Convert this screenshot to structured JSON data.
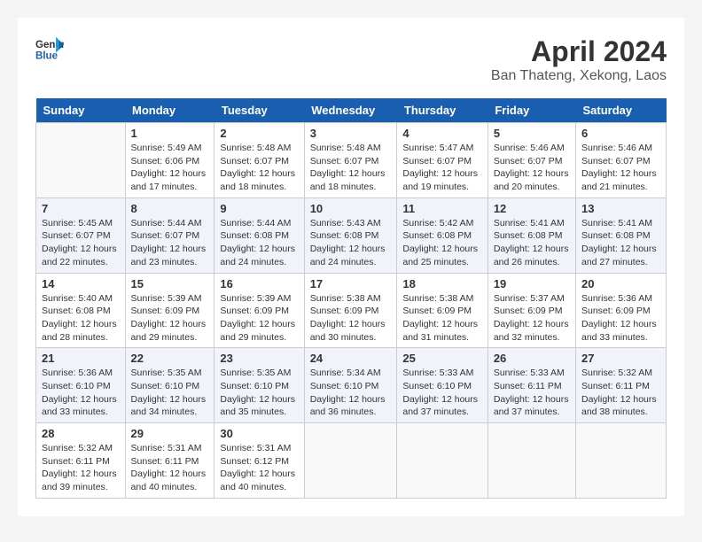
{
  "header": {
    "logo_line1": "General",
    "logo_line2": "Blue",
    "title": "April 2024",
    "location": "Ban Thateng, Xekong, Laos"
  },
  "columns": [
    "Sunday",
    "Monday",
    "Tuesday",
    "Wednesday",
    "Thursday",
    "Friday",
    "Saturday"
  ],
  "weeks": [
    [
      {
        "day": "",
        "info": ""
      },
      {
        "day": "1",
        "info": "Sunrise: 5:49 AM\nSunset: 6:06 PM\nDaylight: 12 hours\nand 17 minutes."
      },
      {
        "day": "2",
        "info": "Sunrise: 5:48 AM\nSunset: 6:07 PM\nDaylight: 12 hours\nand 18 minutes."
      },
      {
        "day": "3",
        "info": "Sunrise: 5:48 AM\nSunset: 6:07 PM\nDaylight: 12 hours\nand 18 minutes."
      },
      {
        "day": "4",
        "info": "Sunrise: 5:47 AM\nSunset: 6:07 PM\nDaylight: 12 hours\nand 19 minutes."
      },
      {
        "day": "5",
        "info": "Sunrise: 5:46 AM\nSunset: 6:07 PM\nDaylight: 12 hours\nand 20 minutes."
      },
      {
        "day": "6",
        "info": "Sunrise: 5:46 AM\nSunset: 6:07 PM\nDaylight: 12 hours\nand 21 minutes."
      }
    ],
    [
      {
        "day": "7",
        "info": "Sunrise: 5:45 AM\nSunset: 6:07 PM\nDaylight: 12 hours\nand 22 minutes."
      },
      {
        "day": "8",
        "info": "Sunrise: 5:44 AM\nSunset: 6:07 PM\nDaylight: 12 hours\nand 23 minutes."
      },
      {
        "day": "9",
        "info": "Sunrise: 5:44 AM\nSunset: 6:08 PM\nDaylight: 12 hours\nand 24 minutes."
      },
      {
        "day": "10",
        "info": "Sunrise: 5:43 AM\nSunset: 6:08 PM\nDaylight: 12 hours\nand 24 minutes."
      },
      {
        "day": "11",
        "info": "Sunrise: 5:42 AM\nSunset: 6:08 PM\nDaylight: 12 hours\nand 25 minutes."
      },
      {
        "day": "12",
        "info": "Sunrise: 5:41 AM\nSunset: 6:08 PM\nDaylight: 12 hours\nand 26 minutes."
      },
      {
        "day": "13",
        "info": "Sunrise: 5:41 AM\nSunset: 6:08 PM\nDaylight: 12 hours\nand 27 minutes."
      }
    ],
    [
      {
        "day": "14",
        "info": "Sunrise: 5:40 AM\nSunset: 6:08 PM\nDaylight: 12 hours\nand 28 minutes."
      },
      {
        "day": "15",
        "info": "Sunrise: 5:39 AM\nSunset: 6:09 PM\nDaylight: 12 hours\nand 29 minutes."
      },
      {
        "day": "16",
        "info": "Sunrise: 5:39 AM\nSunset: 6:09 PM\nDaylight: 12 hours\nand 29 minutes."
      },
      {
        "day": "17",
        "info": "Sunrise: 5:38 AM\nSunset: 6:09 PM\nDaylight: 12 hours\nand 30 minutes."
      },
      {
        "day": "18",
        "info": "Sunrise: 5:38 AM\nSunset: 6:09 PM\nDaylight: 12 hours\nand 31 minutes."
      },
      {
        "day": "19",
        "info": "Sunrise: 5:37 AM\nSunset: 6:09 PM\nDaylight: 12 hours\nand 32 minutes."
      },
      {
        "day": "20",
        "info": "Sunrise: 5:36 AM\nSunset: 6:09 PM\nDaylight: 12 hours\nand 33 minutes."
      }
    ],
    [
      {
        "day": "21",
        "info": "Sunrise: 5:36 AM\nSunset: 6:10 PM\nDaylight: 12 hours\nand 33 minutes."
      },
      {
        "day": "22",
        "info": "Sunrise: 5:35 AM\nSunset: 6:10 PM\nDaylight: 12 hours\nand 34 minutes."
      },
      {
        "day": "23",
        "info": "Sunrise: 5:35 AM\nSunset: 6:10 PM\nDaylight: 12 hours\nand 35 minutes."
      },
      {
        "day": "24",
        "info": "Sunrise: 5:34 AM\nSunset: 6:10 PM\nDaylight: 12 hours\nand 36 minutes."
      },
      {
        "day": "25",
        "info": "Sunrise: 5:33 AM\nSunset: 6:10 PM\nDaylight: 12 hours\nand 37 minutes."
      },
      {
        "day": "26",
        "info": "Sunrise: 5:33 AM\nSunset: 6:11 PM\nDaylight: 12 hours\nand 37 minutes."
      },
      {
        "day": "27",
        "info": "Sunrise: 5:32 AM\nSunset: 6:11 PM\nDaylight: 12 hours\nand 38 minutes."
      }
    ],
    [
      {
        "day": "28",
        "info": "Sunrise: 5:32 AM\nSunset: 6:11 PM\nDaylight: 12 hours\nand 39 minutes."
      },
      {
        "day": "29",
        "info": "Sunrise: 5:31 AM\nSunset: 6:11 PM\nDaylight: 12 hours\nand 40 minutes."
      },
      {
        "day": "30",
        "info": "Sunrise: 5:31 AM\nSunset: 6:12 PM\nDaylight: 12 hours\nand 40 minutes."
      },
      {
        "day": "",
        "info": ""
      },
      {
        "day": "",
        "info": ""
      },
      {
        "day": "",
        "info": ""
      },
      {
        "day": "",
        "info": ""
      }
    ]
  ]
}
